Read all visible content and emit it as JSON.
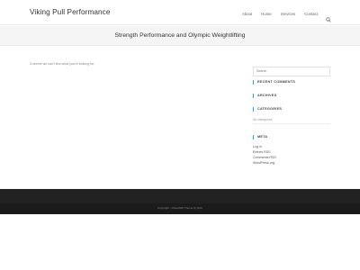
{
  "header": {
    "site_title": "Viking Pull Performance",
    "nav": [
      "About",
      "Home",
      "Services",
      "Contact"
    ]
  },
  "banner": {
    "title": "Strength Performance and Olympic Weightlifting"
  },
  "main": {
    "not_found": "It seems we can't find what you're looking for."
  },
  "sidebar": {
    "search_placeholder": "Search",
    "recent_comments": "RECENT COMMENTS",
    "archives": "ARCHIVES",
    "categories": "CATEGORIES",
    "no_categories": "No categories",
    "meta": "META",
    "meta_links": [
      "Log in",
      "Entries RSS",
      "Comments RSS",
      "WordPress.org"
    ]
  },
  "footer": {
    "copyright": "Copyright - OceanWP Theme by Nick"
  },
  "colors": {
    "accent": "#13aff0",
    "footer_bg": "#222222",
    "banner_bg": "#f5f5f5"
  }
}
